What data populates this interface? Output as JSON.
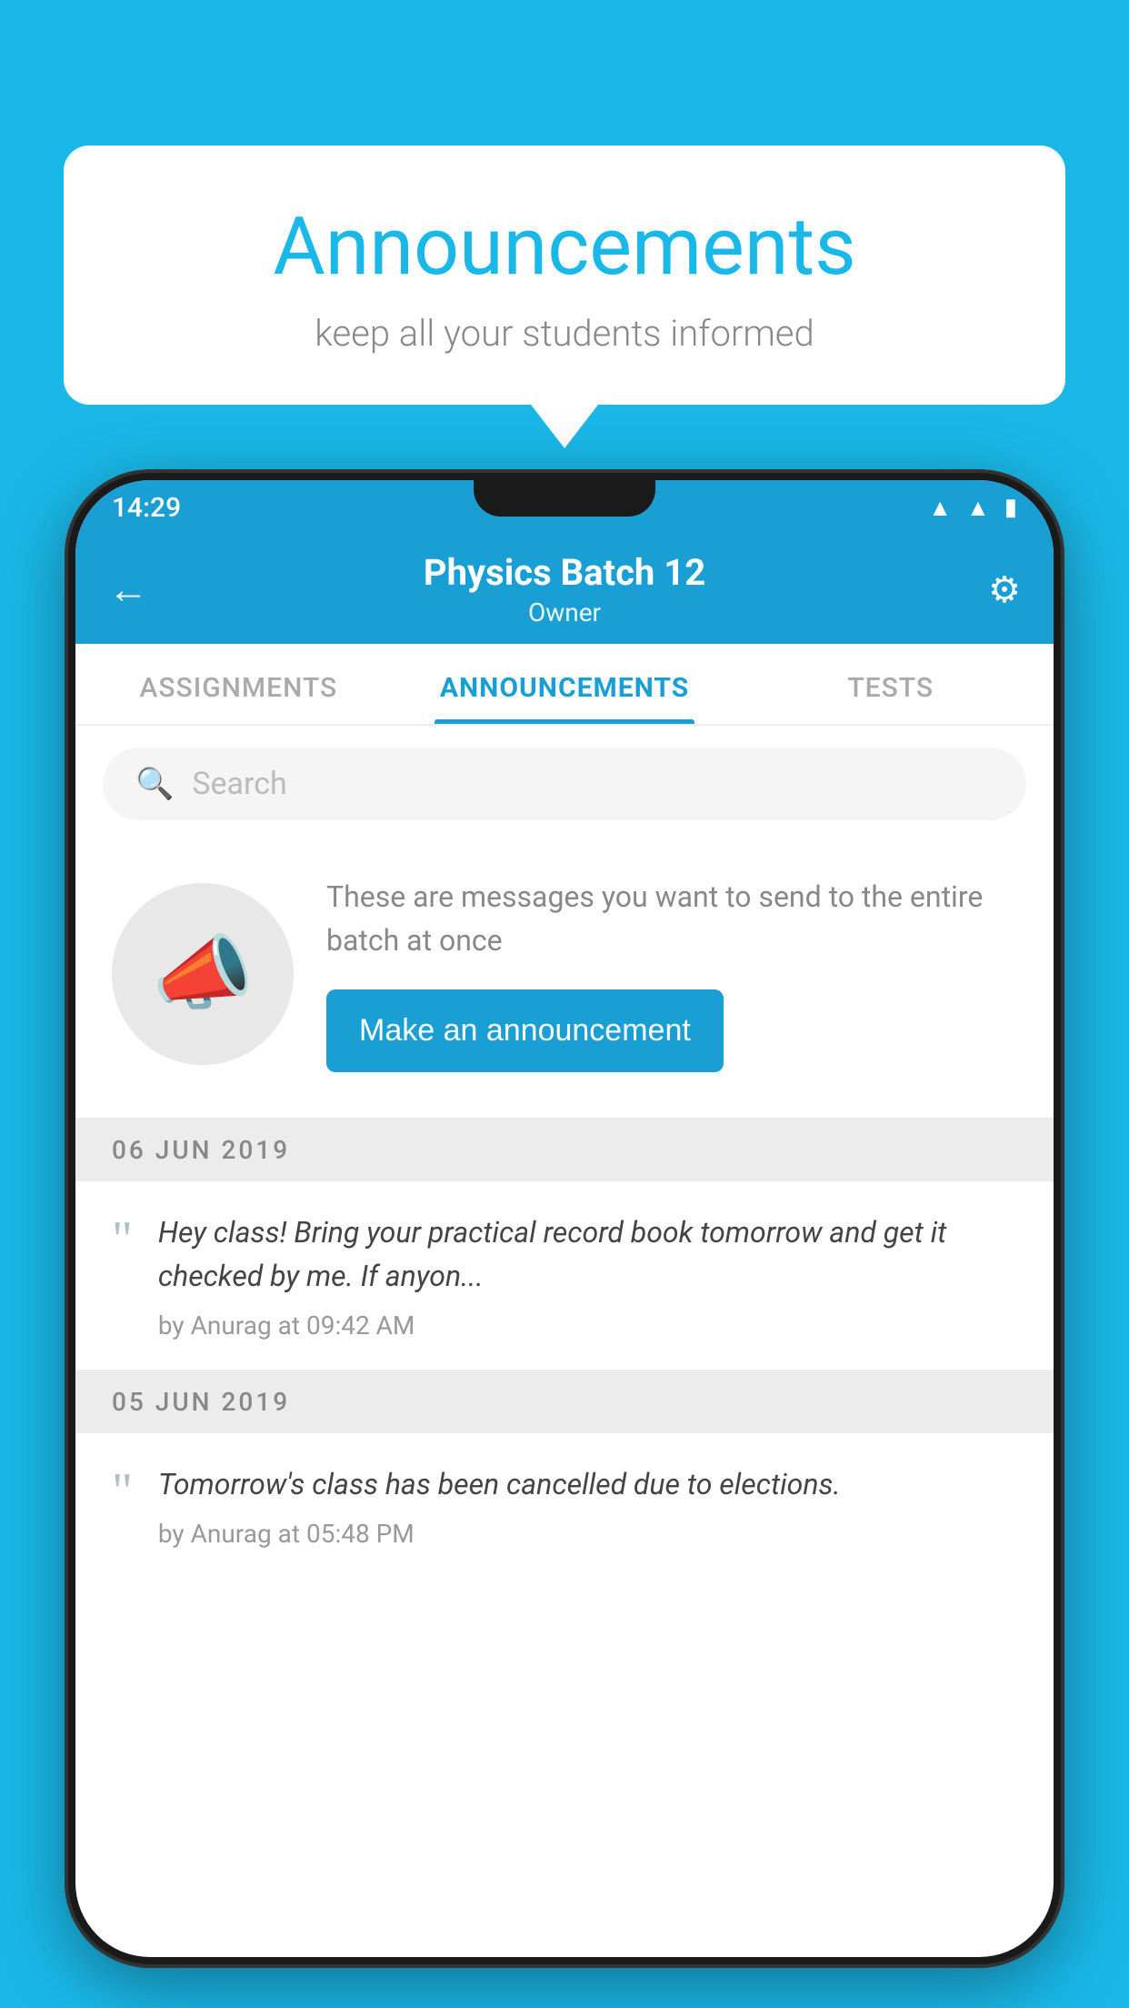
{
  "bubble": {
    "title": "Announcements",
    "subtitle": "keep all your students informed"
  },
  "statusBar": {
    "time": "14:29",
    "icons": [
      "wifi",
      "signal",
      "battery"
    ]
  },
  "topBar": {
    "title": "Physics Batch 12",
    "subtitle": "Owner",
    "backLabel": "←",
    "settingsLabel": "⚙"
  },
  "tabs": [
    {
      "label": "ASSIGNMENTS",
      "active": false
    },
    {
      "label": "ANNOUNCEMENTS",
      "active": true
    },
    {
      "label": "TESTS",
      "active": false
    }
  ],
  "search": {
    "placeholder": "Search"
  },
  "promo": {
    "description": "These are messages you want to send to the entire batch at once",
    "buttonLabel": "Make an announcement"
  },
  "announcements": [
    {
      "date": "06  JUN  2019",
      "text": "Hey class! Bring your practical record book tomorrow and get it checked by me. If anyon...",
      "meta": "by Anurag at 09:42 AM"
    },
    {
      "date": "05  JUN  2019",
      "text": "Tomorrow's class has been cancelled due to elections.",
      "meta": "by Anurag at 05:48 PM"
    }
  ]
}
